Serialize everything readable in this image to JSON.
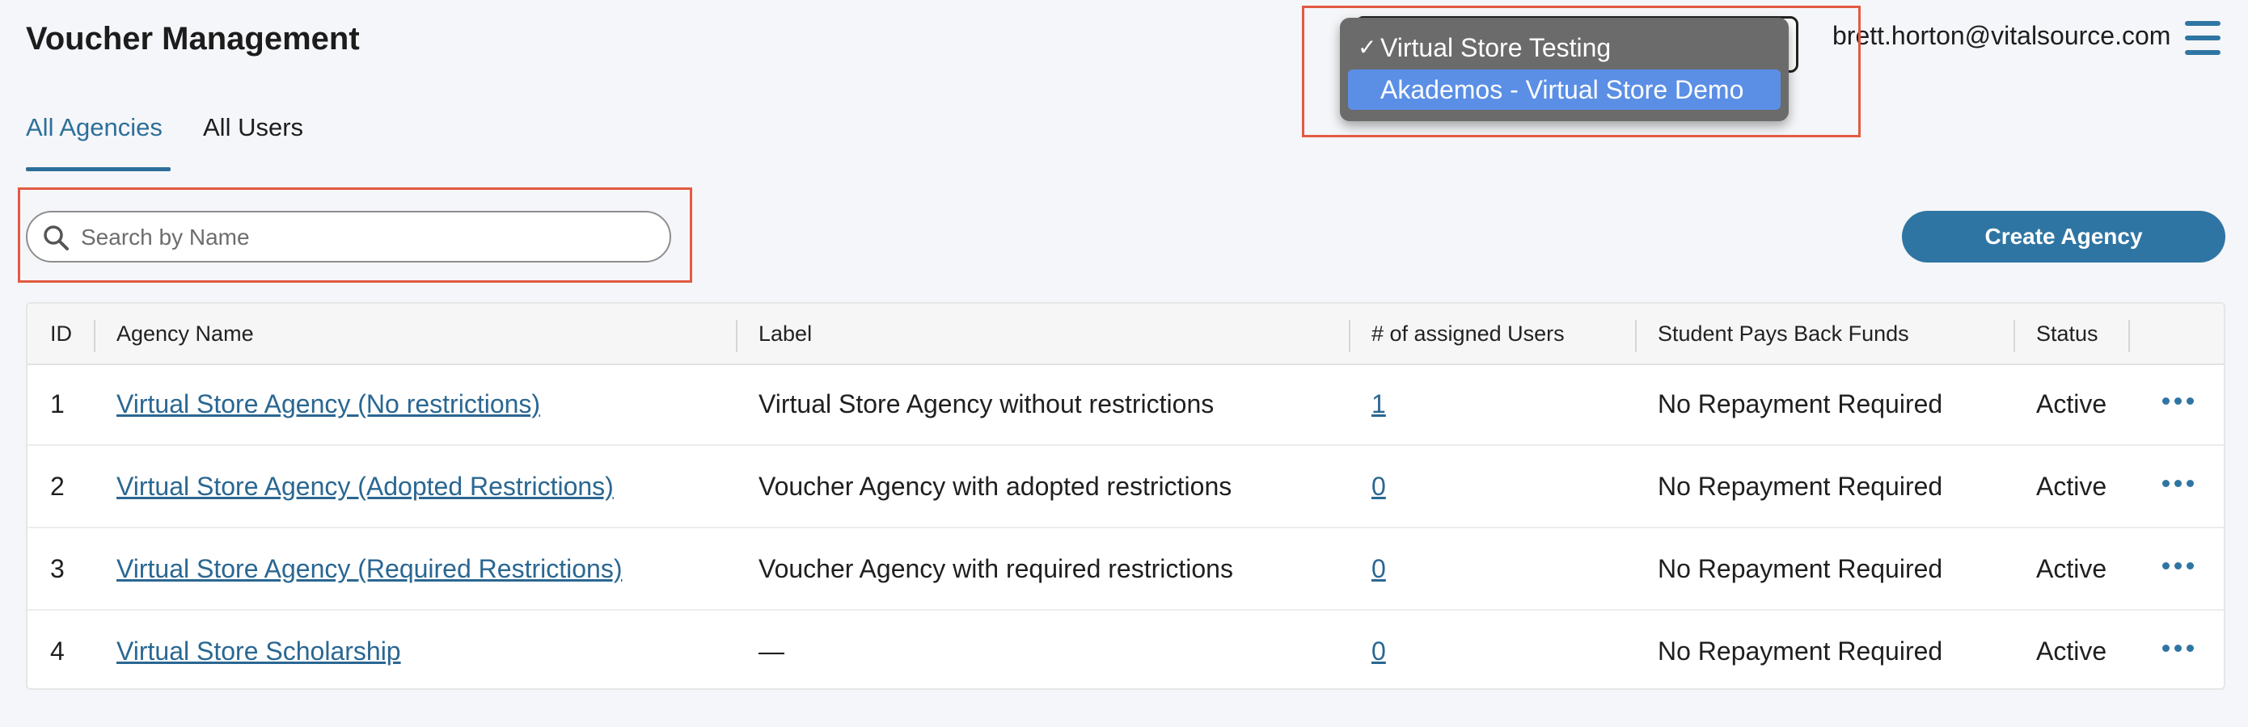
{
  "header": {
    "title": "Voucher Management",
    "user_email": "brett.horton@vitalsource.com",
    "menu_icon": "hamburger-menu-icon"
  },
  "tabs": [
    {
      "label": "All Agencies",
      "active": true
    },
    {
      "label": "All Users",
      "active": false
    }
  ],
  "search": {
    "placeholder": "Search by Name",
    "value": "",
    "icon": "search-icon"
  },
  "store_select": {
    "options": [
      {
        "label": "Virtual Store Testing",
        "checked": true,
        "check_mark": "✓"
      },
      {
        "label": "Akademos - Virtual Store Demo",
        "highlighted": true
      }
    ]
  },
  "actions": {
    "create_agency_label": "Create Agency"
  },
  "table": {
    "columns": [
      "ID",
      "Agency Name",
      "Label",
      "# of assigned Users",
      "Student Pays Back Funds",
      "Status"
    ],
    "rows": [
      {
        "id": "1",
        "name": "Virtual Store Agency (No restrictions)",
        "label": "Virtual Store Agency without restrictions",
        "users": "1",
        "pays_back": "No Repayment Required",
        "status": "Active"
      },
      {
        "id": "2",
        "name": "Virtual Store Agency (Adopted Restrictions)",
        "label": "Voucher Agency with adopted restrictions",
        "users": "0",
        "pays_back": "No Repayment Required",
        "status": "Active"
      },
      {
        "id": "3",
        "name": "Virtual Store Agency (Required Restrictions)",
        "label": "Voucher Agency with required restrictions",
        "users": "0",
        "pays_back": "No Repayment Required",
        "status": "Active"
      },
      {
        "id": "4",
        "name": "Virtual Store Scholarship",
        "label": "—",
        "users": "0",
        "pays_back": "No Repayment Required",
        "status": "Active"
      }
    ],
    "row_action_icon": "more-horizontal-icon"
  },
  "colors": {
    "accent": "#2f75a3",
    "link": "#2a6792",
    "highlight_box": "#e25a42",
    "dropdown_bg": "#6b6b6b",
    "dropdown_selected": "#5b8fe5"
  }
}
